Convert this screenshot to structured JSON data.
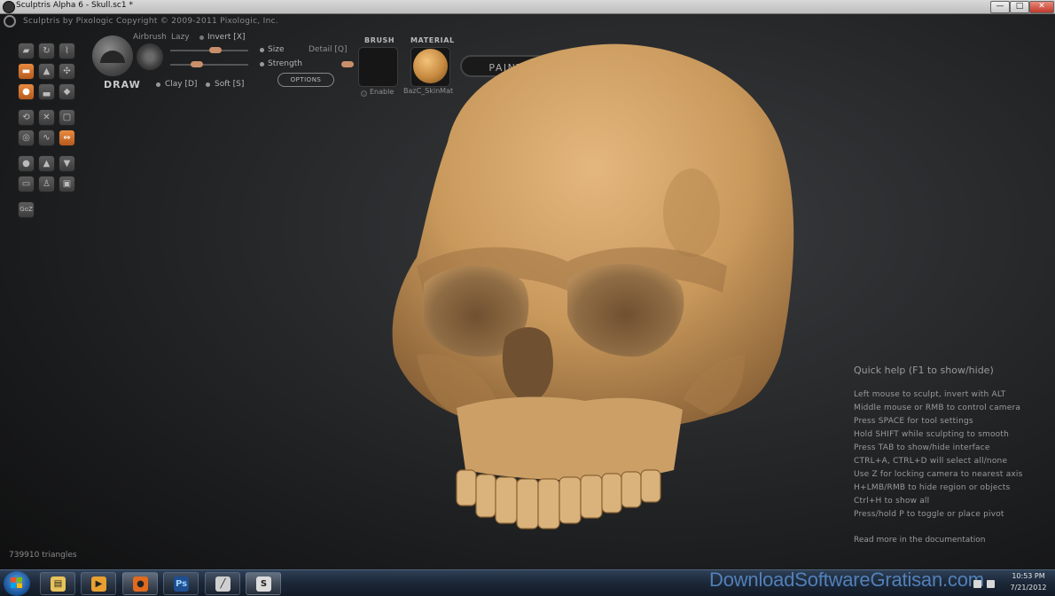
{
  "window": {
    "title": "Sculptris Alpha 6 - Skull.sc1 *",
    "controls": {
      "minimize": "—",
      "maximize": "□",
      "close": "✕"
    }
  },
  "app": {
    "copyright": "Sculptris by Pixologic   Copyright © 2009-2011 Pixologic, Inc.",
    "logo_icon": "sculptris-logo-icon"
  },
  "toolbar": {
    "brush_name": "DRAW",
    "airbrush": "Airbrush",
    "lazy": "Lazy",
    "invert": "Invert [X]",
    "size": "Size",
    "strength": "Strength",
    "detail": "Detail [Q]",
    "clay": "Clay [D]",
    "soft": "Soft [S]",
    "options": "OPTIONS",
    "brush_header": "BRUSH",
    "material_header": "MATERIAL",
    "enable": "Enable",
    "material_name": "BazC_SkinMat",
    "paint": "PAINT"
  },
  "tools": [
    {
      "name": "draw-tool-icon",
      "glyph": "▰",
      "active": false
    },
    {
      "name": "rotate-tool-icon",
      "glyph": "↻",
      "active": false
    },
    {
      "name": "crease-tool-icon",
      "glyph": "⌇",
      "active": false
    },
    {
      "name": "flatten-tool-icon",
      "glyph": "▬",
      "active": true
    },
    {
      "name": "inflate-tool-icon",
      "glyph": "▲",
      "active": false
    },
    {
      "name": "pinch-tool-icon",
      "glyph": "✣",
      "active": false
    },
    {
      "name": "grab-tool-icon",
      "glyph": "●",
      "active": true
    },
    {
      "name": "smooth-tool-icon",
      "glyph": "▃",
      "active": false
    },
    {
      "name": "reduce-tool-icon",
      "glyph": "◆",
      "active": false
    },
    {
      "name": "reset-tool-icon",
      "glyph": "⟲",
      "active": false
    },
    {
      "name": "mask-tool-icon",
      "glyph": "✕",
      "active": false
    },
    {
      "name": "frame-tool-icon",
      "glyph": "▢",
      "active": false
    },
    {
      "name": "subdivide-tool-icon",
      "glyph": "◎",
      "active": false
    },
    {
      "name": "wave-tool-icon",
      "glyph": "∿",
      "active": false
    },
    {
      "name": "symmetry-tool-icon",
      "glyph": "⇔",
      "active": true
    },
    {
      "name": "sphere-tool-icon",
      "glyph": "●",
      "active": false
    },
    {
      "name": "import-tool-icon",
      "glyph": "▲",
      "active": false
    },
    {
      "name": "export-tool-icon",
      "glyph": "▼",
      "active": false
    },
    {
      "name": "plane-tool-icon",
      "glyph": "▭",
      "active": false
    },
    {
      "name": "figure-tool-icon",
      "glyph": "♙",
      "active": false
    },
    {
      "name": "cube-tool-icon",
      "glyph": "▣",
      "active": false
    },
    {
      "name": "goz-tool-icon",
      "glyph": "GoZ",
      "active": false
    }
  ],
  "quick_help": {
    "title": "Quick help (F1 to show/hide)",
    "lines": [
      "Left mouse to sculpt, invert with ALT",
      "Middle mouse or RMB to control camera",
      "Press SPACE for tool settings",
      "Hold SHIFT while sculpting to smooth",
      "Press TAB to show/hide interface",
      "CTRL+A, CTRL+D will select all/none",
      "Use Z for locking camera to nearest axis",
      "H+LMB/RMB to hide region or objects",
      "Ctrl+H to show all",
      "Press/hold P to toggle or place pivot"
    ],
    "footer": "Read more in the documentation"
  },
  "status": {
    "triangles": "739910 triangles"
  },
  "taskbar": {
    "buttons": [
      {
        "name": "explorer-taskbar-button",
        "icon": "folder-icon",
        "glyph": "▤",
        "color": "#e8c25a",
        "active": false
      },
      {
        "name": "mediaplayer-taskbar-button",
        "icon": "play-icon",
        "glyph": "▶",
        "color": "#e8a030",
        "active": false
      },
      {
        "name": "firefox-taskbar-button",
        "icon": "firefox-icon",
        "glyph": "●",
        "color": "#e06a1f",
        "active": true
      },
      {
        "name": "photoshop-taskbar-button",
        "icon": "photoshop-icon",
        "glyph": "Ps",
        "color": "#1d4f91",
        "active": false
      },
      {
        "name": "brush-taskbar-button",
        "icon": "brush-icon",
        "glyph": "╱",
        "color": "#cfcfcf",
        "active": false
      },
      {
        "name": "sculptris-taskbar-button",
        "icon": "sculptris-icon",
        "glyph": "S",
        "color": "#dcdcdc",
        "active": true
      }
    ],
    "watermark": "DownloadSoftwareGratisan.com",
    "time": "10:53 PM",
    "date": "7/21/2012"
  }
}
